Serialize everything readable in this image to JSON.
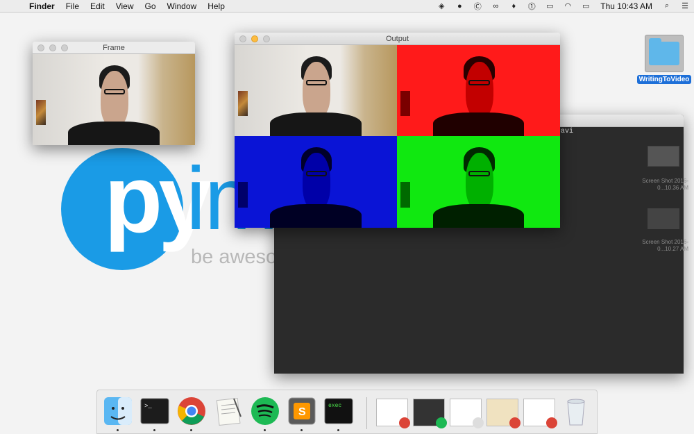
{
  "menubar": {
    "app": "Finder",
    "menus": [
      "File",
      "Edit",
      "View",
      "Go",
      "Window",
      "Help"
    ],
    "status_icons": [
      "dropbox-icon",
      "evernote-icon",
      "copyclip-icon",
      "creative-cloud-icon",
      "alfred-icon",
      "1password-icon",
      "airplay-icon",
      "wifi-icon",
      "battery-icon"
    ],
    "clock": "Thu 10:43 AM"
  },
  "wallpaper": {
    "logo_py": "py",
    "logo_rest": "imagesearch",
    "tagline": "be awesome at building image search engines"
  },
  "windows": {
    "frame": {
      "title": "Frame"
    },
    "output": {
      "title": "Output"
    },
    "terminal": {
      "partial_text": "avi"
    }
  },
  "desktop": {
    "folder_label": "WritingToVideo",
    "screenshot_label_1": "Screen Shot 2016-0...10.36 AM",
    "screenshot_label_2": "Screen Shot 2016-0...10.27 AM"
  },
  "dock": {
    "apps": [
      "Finder",
      "Terminal",
      "Google Chrome",
      "TextEdit",
      "Spotify",
      "Sublime Text",
      "exec"
    ],
    "exec_label": "exec"
  }
}
